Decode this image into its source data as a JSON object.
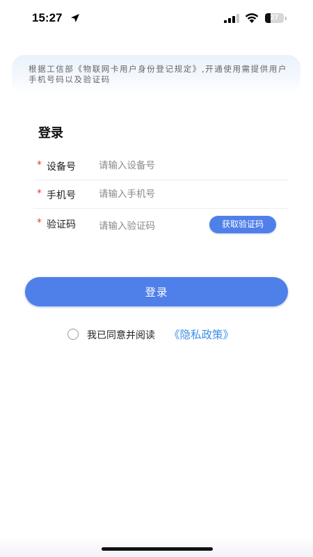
{
  "status_bar": {
    "time": "15:27",
    "battery": "27",
    "icons": [
      "location-arrow-icon",
      "cellular-signal-icon",
      "wifi-icon",
      "battery-icon"
    ]
  },
  "notice": {
    "text": "根据工信部《物联网卡用户身份登记规定》,开通使用需提供用户手机号码以及验证码"
  },
  "form": {
    "title": "登录",
    "required_mark": "*",
    "fields": [
      {
        "label": "设备号",
        "placeholder": "请输入设备号",
        "value": ""
      },
      {
        "label": "手机号",
        "placeholder": "请输入手机号",
        "value": ""
      },
      {
        "label": "验证码",
        "placeholder": "请输入验证码",
        "value": ""
      }
    ],
    "get_code_label": "获取验证码",
    "submit_label": "登录"
  },
  "agreement": {
    "checked": false,
    "text": "我已同意并阅读",
    "link": "《隐私政策》"
  },
  "colors": {
    "primary": "#4f7fe9",
    "link": "#3d8fe6",
    "required": "#e53935"
  }
}
